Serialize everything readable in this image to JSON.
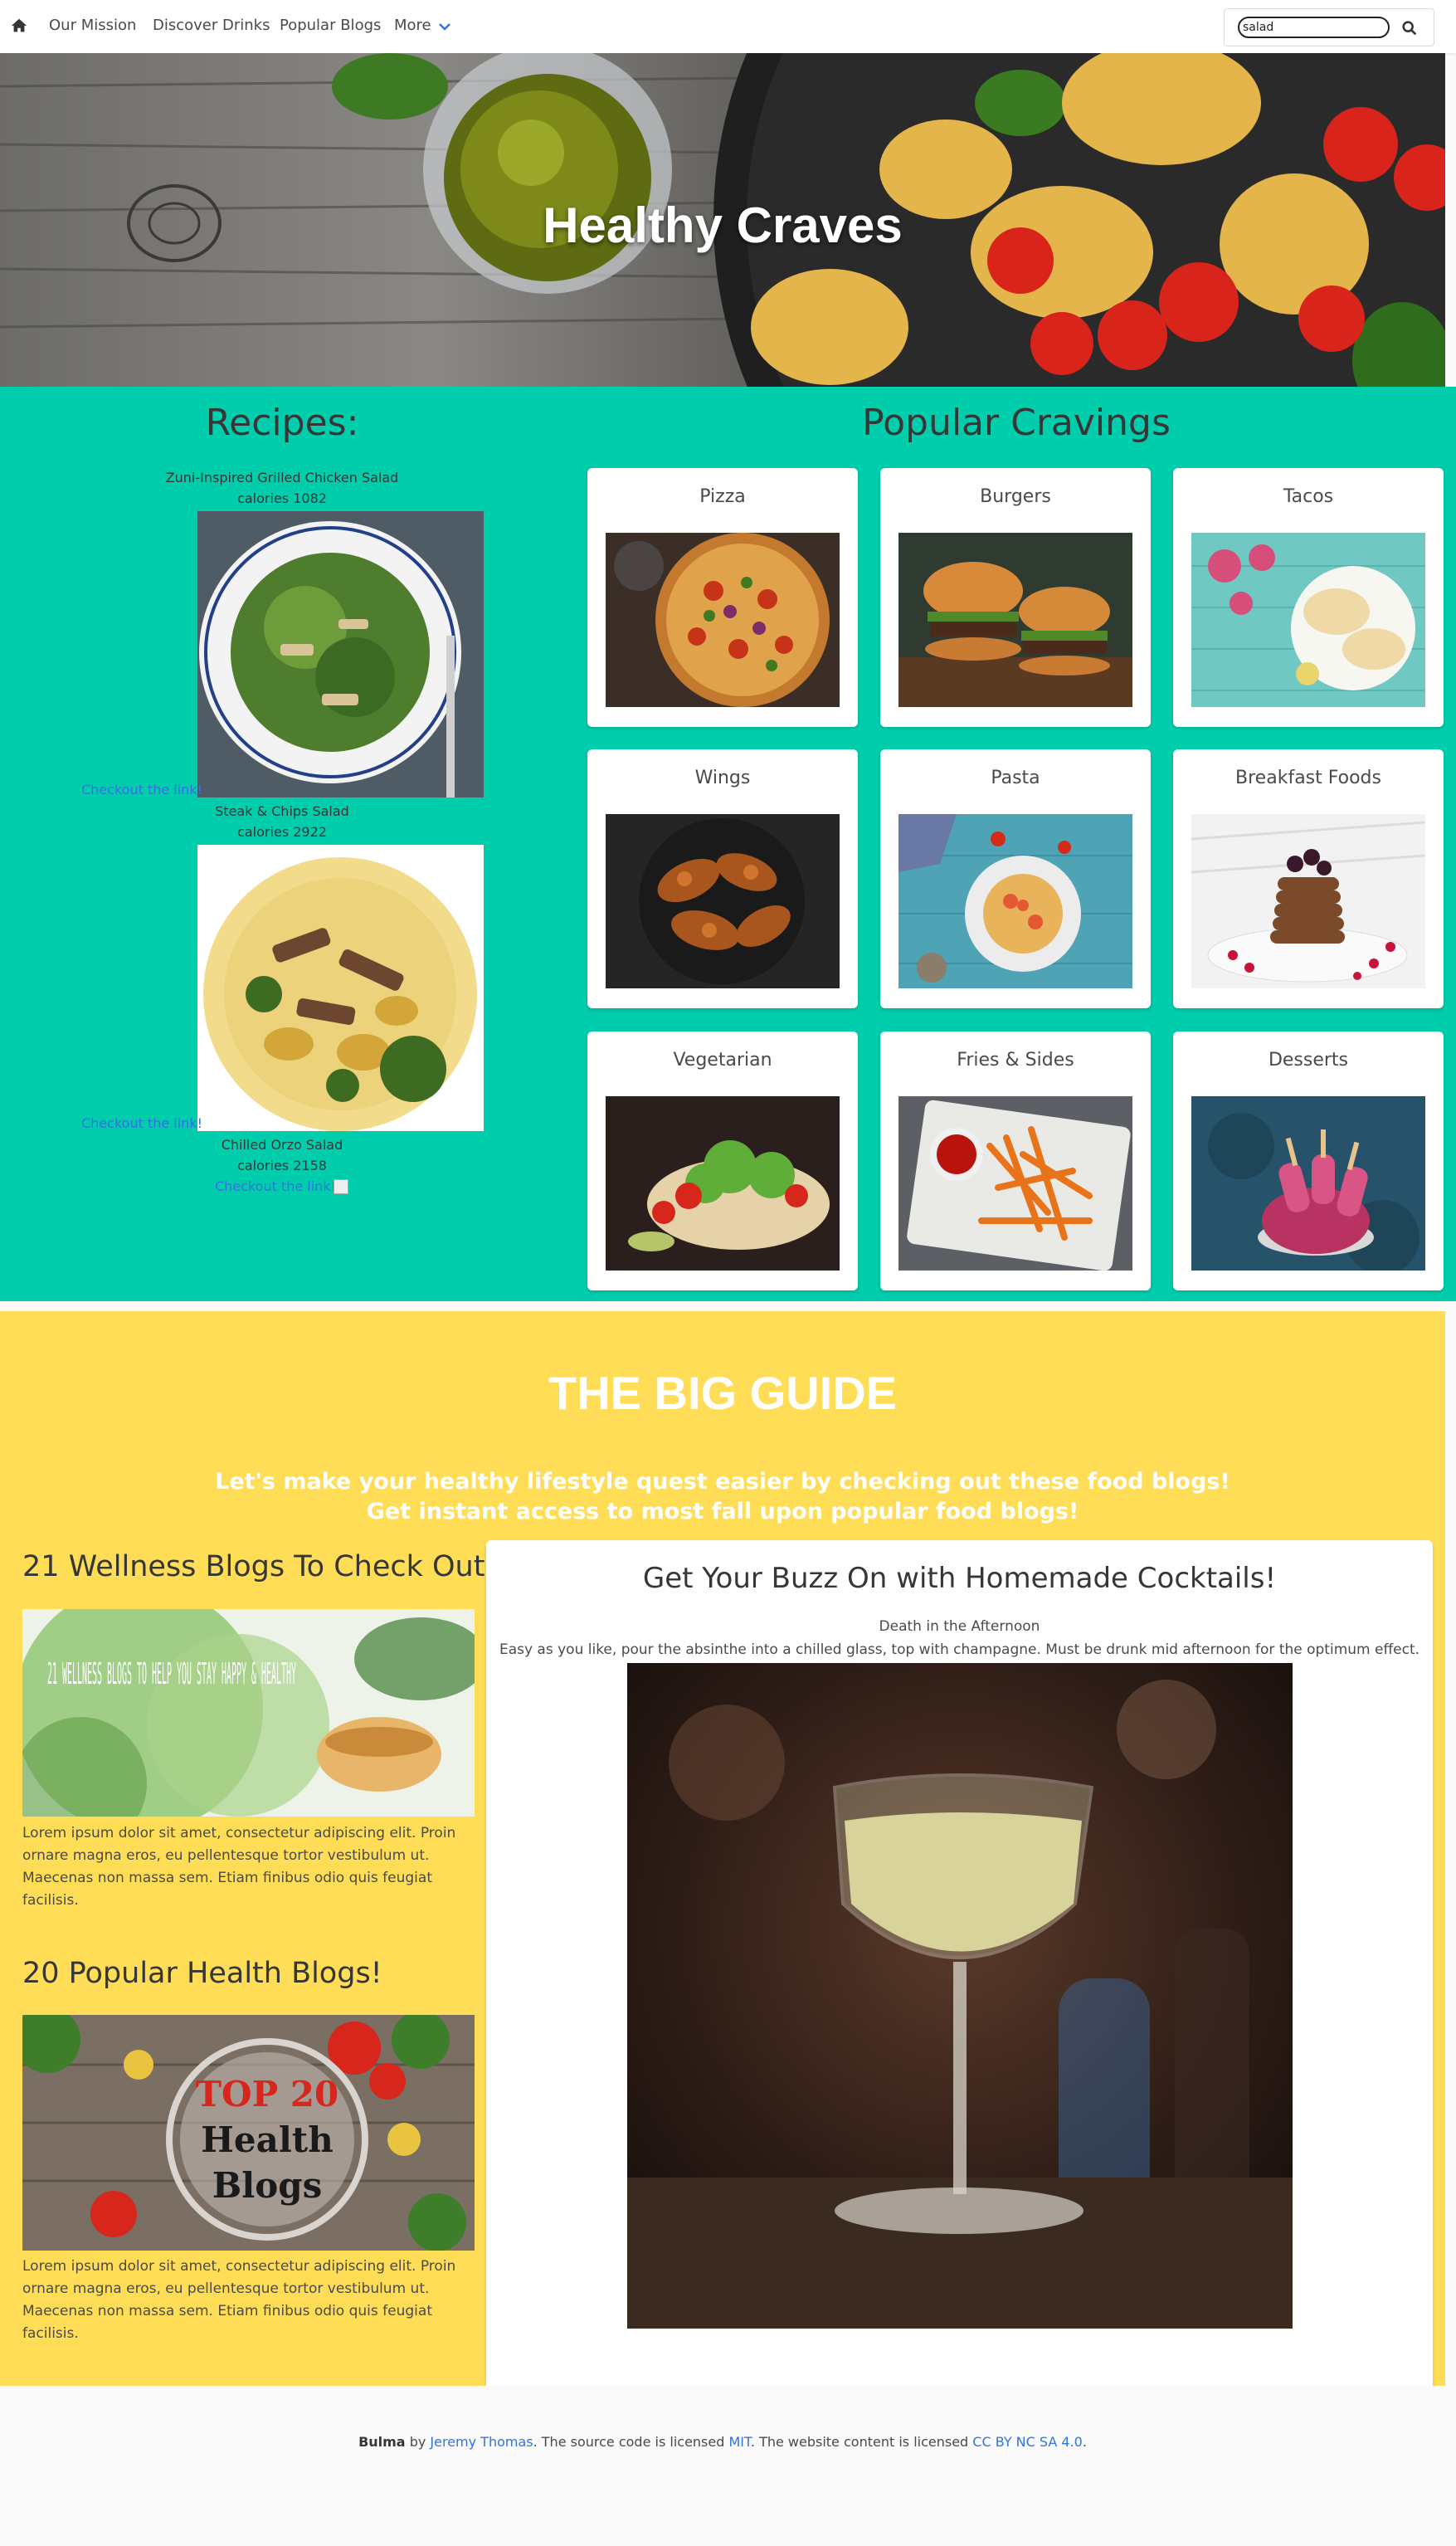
{
  "nav": {
    "items": [
      "Our Mission",
      "Discover Drinks",
      "Popular Blogs",
      "More"
    ],
    "search_value": "salad"
  },
  "hero": {
    "title": "Healthy Craves"
  },
  "recipes": {
    "title": "Recipes:",
    "items": [
      {
        "name": "Zuni-Inspired Grilled Chicken Salad",
        "calories": "calories 1082",
        "link": "Checkout the link!"
      },
      {
        "name": "Steak & Chips Salad",
        "calories": "calories 2922",
        "link": "Checkout the link!"
      },
      {
        "name": "Chilled Orzo Salad",
        "calories": "calories 2158",
        "link": "Checkout the link!"
      }
    ]
  },
  "cravings": {
    "title": "Popular Cravings",
    "cards": [
      "Pizza",
      "Burgers",
      "Tacos",
      "Wings",
      "Pasta",
      "Breakfast Foods",
      "Vegetarian",
      "Fries & Sides",
      "Desserts"
    ]
  },
  "guide": {
    "title": "THE BIG GUIDE",
    "subtitle_1": "Let's make your healthy lifestyle quest easier by checking out these food blogs!",
    "subtitle_2": "Get instant access to most fall upon popular food blogs!",
    "blogs": [
      {
        "title": "21 Wellness Blogs To Check Out!",
        "image_text": "21 WELLNESS BLOGS TO HELP YOU STAY HAPPY & HEALTHY",
        "text": "Lorem ipsum dolor sit amet, consectetur adipiscing elit. Proin ornare magna eros, eu pellentesque tortor vestibulum ut. Maecenas non massa sem. Etiam finibus odio quis feugiat facilisis."
      },
      {
        "title": "20 Popular Health Blogs!",
        "image_text_1": "TOP 20",
        "image_text_2": "Health",
        "image_text_3": "Blogs",
        "text": "Lorem ipsum dolor sit amet, consectetur adipiscing elit. Proin ornare magna eros, eu pellentesque tortor vestibulum ut. Maecenas non massa sem. Etiam finibus odio quis feugiat facilisis."
      }
    ],
    "cocktail": {
      "title": "Get Your Buzz On with Homemade Cocktails!",
      "name": "Death in the Afternoon",
      "description": "Easy as you like, pour the absinthe into a chilled glass, top with champagne. Must be drunk mid afternoon for the optimum effect."
    }
  },
  "footer": {
    "brand": "Bulma",
    "by": " by ",
    "author": "Jeremy Thomas",
    "mid": ". The source code is licensed ",
    "license1": "MIT",
    "mid2": ". The website content is licensed ",
    "license2": "CC BY NC SA 4.0",
    "end": "."
  },
  "colors": {
    "teal": "#00cdac",
    "yellow": "#ffdd57",
    "link": "#3273dc"
  }
}
